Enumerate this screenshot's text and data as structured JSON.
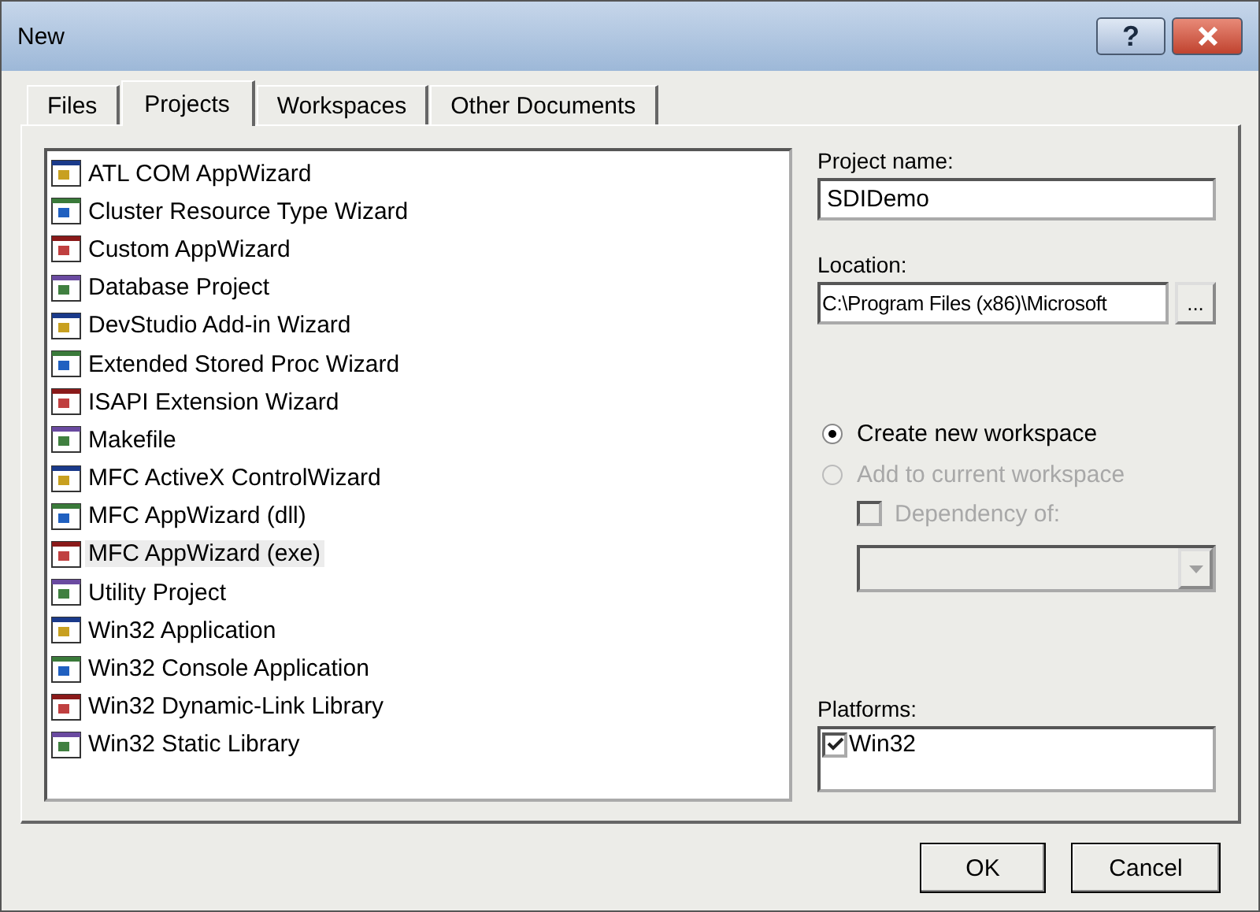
{
  "window": {
    "title": "New",
    "help_button": "?"
  },
  "tabs": [
    {
      "label": "Files",
      "selected": false
    },
    {
      "label": "Projects",
      "selected": true
    },
    {
      "label": "Workspaces",
      "selected": false
    },
    {
      "label": "Other Documents",
      "selected": false
    }
  ],
  "project_types": [
    {
      "label": "ATL COM AppWizard",
      "selected": false
    },
    {
      "label": "Cluster Resource Type Wizard",
      "selected": false
    },
    {
      "label": "Custom AppWizard",
      "selected": false
    },
    {
      "label": "Database Project",
      "selected": false
    },
    {
      "label": "DevStudio Add-in Wizard",
      "selected": false
    },
    {
      "label": "Extended Stored Proc Wizard",
      "selected": false
    },
    {
      "label": "ISAPI Extension Wizard",
      "selected": false
    },
    {
      "label": "Makefile",
      "selected": false
    },
    {
      "label": "MFC ActiveX ControlWizard",
      "selected": false
    },
    {
      "label": "MFC AppWizard (dll)",
      "selected": false
    },
    {
      "label": "MFC AppWizard (exe)",
      "selected": true
    },
    {
      "label": "Utility Project",
      "selected": false
    },
    {
      "label": "Win32 Application",
      "selected": false
    },
    {
      "label": "Win32 Console Application",
      "selected": false
    },
    {
      "label": "Win32 Dynamic-Link Library",
      "selected": false
    },
    {
      "label": "Win32 Static Library",
      "selected": false
    }
  ],
  "project_name": {
    "label": "Project name:",
    "value": "SDIDemo"
  },
  "location": {
    "label": "Location:",
    "value": "C:\\Program Files (x86)\\Microsoft",
    "browse_button": "..."
  },
  "workspace_options": [
    {
      "label": "Create new workspace",
      "selected": true,
      "disabled": false
    },
    {
      "label": "Add to current workspace",
      "selected": false,
      "disabled": true
    }
  ],
  "dependency": {
    "label": "Dependency of:",
    "checked": false,
    "disabled": true
  },
  "dependency_dropdown": {
    "disabled": true
  },
  "platforms": {
    "label": "Platforms:",
    "items": [
      {
        "label": "Win32",
        "checked": true
      }
    ]
  },
  "buttons": [
    "OK",
    "Cancel"
  ]
}
